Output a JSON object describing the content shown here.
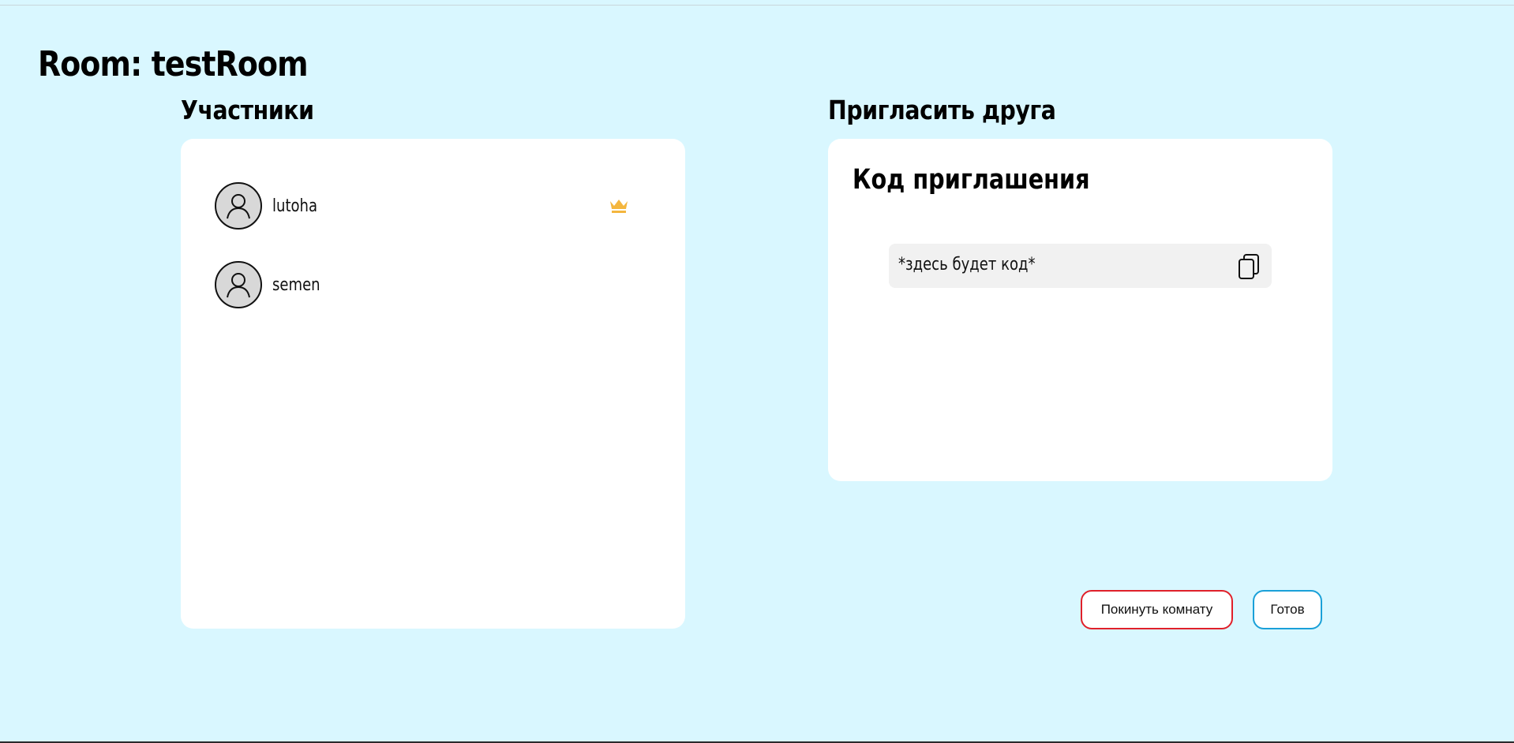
{
  "room": {
    "title": "Room: testRoom"
  },
  "participants": {
    "title": "Участники",
    "members": [
      {
        "name": "lutoha",
        "is_owner": true
      },
      {
        "name": "semen",
        "is_owner": false
      }
    ]
  },
  "invite": {
    "title": "Пригласить друга",
    "code_label": "Код приглашения",
    "code_value": "*здесь будет код*"
  },
  "actions": {
    "leave_label": "Покинуть комнату",
    "ready_label": "Готов"
  },
  "colors": {
    "background": "#d9f7ff",
    "crown": "#f4b63e",
    "leave_border": "#e0202a",
    "ready_border": "#1aa0d8"
  }
}
